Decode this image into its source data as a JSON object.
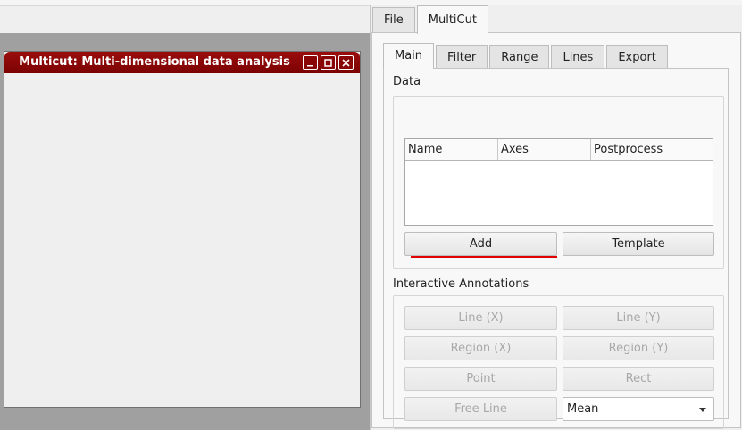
{
  "window": {
    "title": "Multicut: Multi-dimensional data analysis",
    "controls": [
      "minimize-icon",
      "maximize-icon",
      "close-icon"
    ]
  },
  "outer_tabs": [
    {
      "label": "File",
      "active": false
    },
    {
      "label": "MultiCut",
      "active": true
    }
  ],
  "inner_tabs": [
    {
      "label": "Main",
      "active": true
    },
    {
      "label": "Filter",
      "active": false
    },
    {
      "label": "Range",
      "active": false
    },
    {
      "label": "Lines",
      "active": false
    },
    {
      "label": "Export",
      "active": false
    }
  ],
  "data_section": {
    "title": "Data",
    "columns": [
      "Name",
      "Axes",
      "Postprocess"
    ],
    "rows": [],
    "add_label": "Add",
    "template_label": "Template"
  },
  "annotations_section": {
    "title": "Interactive Annotations",
    "buttons": {
      "line_x": "Line (X)",
      "line_y": "Line (Y)",
      "region_x": "Region (X)",
      "region_y": "Region (Y)",
      "point": "Point",
      "rect": "Rect",
      "free_line": "Free Line"
    },
    "mode_select": {
      "value": "Mean"
    }
  },
  "colors": {
    "titlebar": "#8a0505",
    "accent_underline": "#e00000"
  }
}
